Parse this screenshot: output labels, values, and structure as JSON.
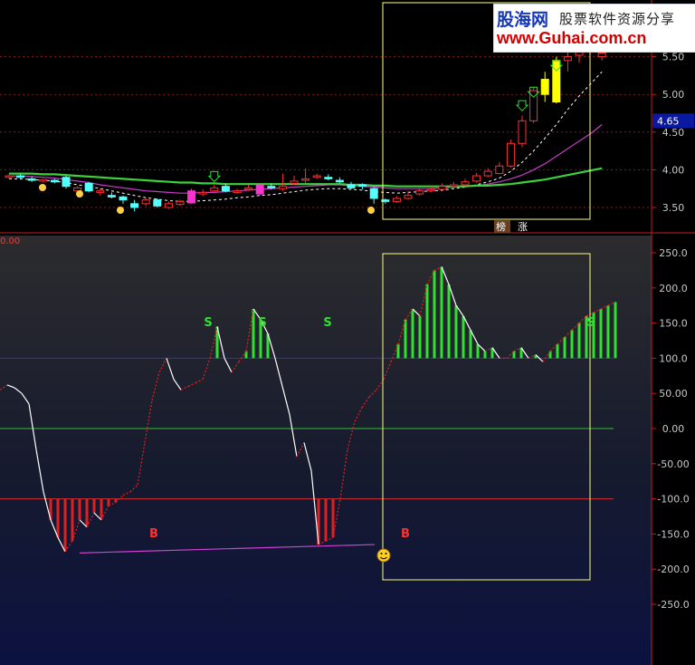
{
  "watermark": {
    "name_cn": "股海网",
    "tagline": "股票软件资源分享",
    "url": "www.Guhai.com.cn"
  },
  "price_panel": {
    "current_price_tag": "4.65",
    "top_left_readout": "0.00",
    "tick_labels": [
      "5.50",
      "5.00",
      "4.50",
      "4.00",
      "3.50"
    ],
    "annotations": [
      "榜",
      "涨"
    ]
  },
  "indicator_panel": {
    "tick_labels": [
      "250.0",
      "200.0",
      "150.0",
      "100.0",
      "50.00",
      "0.00",
      "-50.00",
      "-100.0",
      "-150.0",
      "-200.0",
      "-250.0"
    ],
    "signal_labels": [
      "S",
      "S",
      "S",
      "S",
      "B",
      "B"
    ]
  },
  "colors": {
    "background": "#000000",
    "price_axis": "#c8c8c8",
    "up_candle": "#ff3030",
    "down_candle": "#54ffff",
    "ma_green": "#3cd23c",
    "ma_magenta": "#c83cc8",
    "ma_dashed": "#ffffff",
    "overbought_line": "#3030d0",
    "zero_line": "#30c030",
    "oversold_line": "#d03030",
    "bars_green": "#30e030",
    "bars_red": "#e02020",
    "highlight_box": "#ffff80"
  },
  "chart_data": [
    {
      "type": "candlestick",
      "title": "",
      "ylim": [
        3.25,
        5.8
      ],
      "y_ticks": [
        5.5,
        5.0,
        4.5,
        4.0,
        3.5
      ],
      "current_price": 4.65,
      "candles": [
        [
          3.9,
          3.92,
          3.94,
          3.88
        ],
        [
          3.92,
          3.9,
          3.95,
          3.87
        ],
        [
          3.88,
          3.86,
          3.91,
          3.84
        ],
        [
          3.85,
          3.87,
          3.88,
          3.83
        ],
        [
          3.86,
          3.84,
          3.88,
          3.82
        ],
        [
          3.9,
          3.78,
          3.92,
          3.75
        ],
        [
          3.72,
          3.76,
          3.78,
          3.68
        ],
        [
          3.82,
          3.72,
          3.84,
          3.7
        ],
        [
          3.7,
          3.72,
          3.75,
          3.66
        ],
        [
          3.66,
          3.64,
          3.7,
          3.62
        ],
        [
          3.64,
          3.6,
          3.66,
          3.55
        ],
        [
          3.55,
          3.5,
          3.6,
          3.45
        ],
        [
          3.55,
          3.6,
          3.62,
          3.52
        ],
        [
          3.6,
          3.52,
          3.62,
          3.5
        ],
        [
          3.5,
          3.55,
          3.58,
          3.48
        ],
        [
          3.54,
          3.58,
          3.6,
          3.52
        ],
        [
          3.56,
          3.72,
          3.75,
          3.55
        ],
        [
          3.68,
          3.7,
          3.74,
          3.65
        ],
        [
          3.72,
          3.76,
          3.8,
          3.7
        ],
        [
          3.78,
          3.72,
          3.82,
          3.7
        ],
        [
          3.7,
          3.72,
          3.75,
          3.68
        ],
        [
          3.74,
          3.76,
          3.8,
          3.72
        ],
        [
          3.68,
          3.8,
          3.82,
          3.66
        ],
        [
          3.78,
          3.76,
          3.82,
          3.74
        ],
        [
          3.75,
          3.78,
          3.95,
          3.72
        ],
        [
          3.82,
          3.85,
          3.92,
          3.8
        ],
        [
          3.86,
          3.88,
          4.02,
          3.82
        ],
        [
          3.9,
          3.92,
          3.95,
          3.88
        ],
        [
          3.9,
          3.88,
          3.94,
          3.86
        ],
        [
          3.86,
          3.84,
          3.9,
          3.82
        ],
        [
          3.8,
          3.76,
          3.84,
          3.74
        ],
        [
          3.8,
          3.78,
          3.82,
          3.74
        ],
        [
          3.75,
          3.62,
          3.77,
          3.55
        ],
        [
          3.6,
          3.58,
          3.62,
          3.55
        ],
        [
          3.58,
          3.62,
          3.65,
          3.56
        ],
        [
          3.62,
          3.66,
          3.72,
          3.6
        ],
        [
          3.68,
          3.72,
          3.76,
          3.66
        ],
        [
          3.72,
          3.74,
          3.78,
          3.7
        ],
        [
          3.74,
          3.78,
          3.82,
          3.72
        ],
        [
          3.78,
          3.8,
          3.84,
          3.76
        ],
        [
          3.8,
          3.84,
          3.88,
          3.78
        ],
        [
          3.85,
          3.92,
          3.96,
          3.83
        ],
        [
          3.92,
          3.98,
          4.02,
          3.9
        ],
        [
          3.95,
          4.05,
          4.1,
          3.94
        ],
        [
          4.05,
          4.35,
          4.4,
          4.03
        ],
        [
          4.35,
          4.65,
          4.72,
          4.3
        ],
        [
          4.65,
          5.05,
          5.1,
          4.62
        ],
        [
          5.0,
          5.2,
          5.3,
          4.9
        ],
        [
          4.9,
          5.45,
          5.5,
          4.88
        ],
        [
          5.45,
          5.5,
          5.62,
          5.3
        ],
        [
          5.52,
          5.62,
          5.7,
          5.42
        ],
        [
          5.62,
          5.72,
          5.8,
          5.55
        ],
        [
          5.5,
          5.55,
          5.65,
          5.45
        ]
      ],
      "series": [
        {
          "values": [
            3.88,
            3.88,
            3.87,
            3.86,
            3.85,
            3.83,
            3.8,
            3.78,
            3.75,
            3.72,
            3.69,
            3.66,
            3.63,
            3.61,
            3.59,
            3.58,
            3.58,
            3.59,
            3.6,
            3.61,
            3.63,
            3.64,
            3.66,
            3.67,
            3.69,
            3.71,
            3.73,
            3.74,
            3.75,
            3.75,
            3.74,
            3.73,
            3.71,
            3.7,
            3.69,
            3.7,
            3.71,
            3.72,
            3.73,
            3.75,
            3.77,
            3.8,
            3.84,
            3.89,
            3.98,
            4.1,
            4.25,
            4.42,
            4.6,
            4.8,
            4.98,
            5.14,
            5.3
          ]
        },
        {
          "values": [
            3.92,
            3.92,
            3.91,
            3.9,
            3.89,
            3.87,
            3.85,
            3.83,
            3.8,
            3.78,
            3.76,
            3.74,
            3.72,
            3.71,
            3.7,
            3.69,
            3.69,
            3.7,
            3.7,
            3.71,
            3.72,
            3.73,
            3.74,
            3.75,
            3.76,
            3.77,
            3.78,
            3.79,
            3.8,
            3.8,
            3.79,
            3.78,
            3.77,
            3.76,
            3.75,
            3.75,
            3.75,
            3.75,
            3.76,
            3.77,
            3.78,
            3.79,
            3.81,
            3.84,
            3.88,
            3.93,
            4.0,
            4.08,
            4.18,
            4.28,
            4.38,
            4.48,
            4.6
          ]
        },
        {
          "values": [
            3.95,
            3.95,
            3.95,
            3.94,
            3.94,
            3.93,
            3.92,
            3.91,
            3.9,
            3.89,
            3.88,
            3.87,
            3.86,
            3.85,
            3.84,
            3.83,
            3.83,
            3.82,
            3.82,
            3.81,
            3.81,
            3.81,
            3.81,
            3.81,
            3.81,
            3.81,
            3.81,
            3.81,
            3.81,
            3.81,
            3.8,
            3.8,
            3.79,
            3.79,
            3.78,
            3.78,
            3.78,
            3.78,
            3.78,
            3.78,
            3.78,
            3.79,
            3.79,
            3.8,
            3.81,
            3.83,
            3.85,
            3.87,
            3.9,
            3.93,
            3.96,
            3.99,
            4.02
          ]
        }
      ]
    },
    {
      "type": "line",
      "title": "",
      "ylim": [
        -290,
        260
      ],
      "y_ticks": [
        250,
        200,
        150,
        100,
        50,
        0,
        -50,
        -100,
        -150,
        -200,
        -250
      ],
      "reference_lines": [
        100,
        0,
        -100
      ],
      "x": [
        0,
        8,
        16,
        24,
        32,
        40,
        48,
        56,
        64,
        72,
        80,
        88,
        96,
        104,
        112,
        120,
        128,
        136,
        144,
        152,
        160,
        168,
        176,
        184,
        192,
        200,
        208,
        216,
        224,
        232,
        240,
        248,
        256,
        264,
        272,
        280,
        288,
        296,
        304,
        312,
        320,
        328,
        336,
        344,
        352,
        360,
        368,
        376,
        384,
        392,
        400,
        408,
        416,
        424,
        432,
        440,
        448,
        456,
        464,
        472,
        480,
        488,
        496,
        504,
        512,
        520,
        528,
        536,
        544,
        552,
        560,
        568,
        576,
        584,
        592,
        600,
        608,
        616,
        624,
        632,
        640,
        648,
        656,
        664,
        672,
        680
      ],
      "values": [
        55,
        62,
        58,
        50,
        35,
        -30,
        -90,
        -130,
        -155,
        -175,
        -160,
        -130,
        -140,
        -120,
        -130,
        -110,
        -105,
        -95,
        -90,
        -80,
        -20,
        40,
        80,
        100,
        70,
        55,
        60,
        65,
        70,
        100,
        145,
        100,
        80,
        95,
        110,
        170,
        155,
        135,
        100,
        60,
        20,
        -40,
        -20,
        -60,
        -165,
        -160,
        -155,
        -100,
        -30,
        10,
        30,
        45,
        55,
        70,
        95,
        120,
        155,
        170,
        160,
        205,
        225,
        230,
        205,
        175,
        160,
        140,
        120,
        110,
        115,
        100,
        100,
        110,
        115,
        100,
        105,
        95,
        110,
        120,
        130,
        140,
        150,
        160,
        165,
        170,
        175,
        180
      ],
      "bar_threshold_high": 100,
      "bar_threshold_low": -100
    }
  ]
}
